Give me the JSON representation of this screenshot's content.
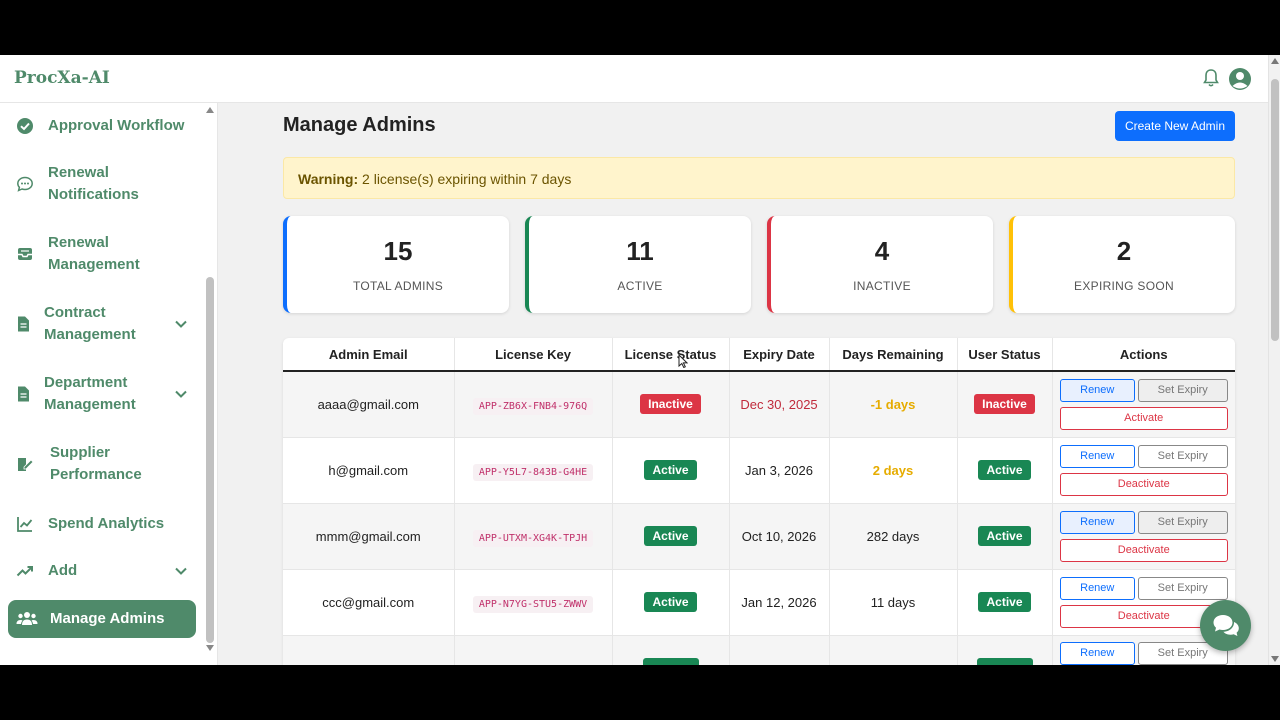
{
  "app": {
    "brand": "ProcXa-AI"
  },
  "sidebar": {
    "items": [
      {
        "line1": "Approval Workflow",
        "line2": "",
        "icon": "check-circle-icon",
        "chevron": false
      },
      {
        "line1": "Renewal",
        "line2": "Notifications",
        "icon": "chat-dots-icon",
        "chevron": false
      },
      {
        "line1": "Renewal",
        "line2": "Management",
        "icon": "inbox-icon",
        "chevron": false
      },
      {
        "line1": "Contract",
        "line2": "Management",
        "icon": "file-icon",
        "chevron": true
      },
      {
        "line1": "Department",
        "line2": "Management",
        "icon": "file-icon",
        "chevron": true
      },
      {
        "line1": "Supplier",
        "line2": "Performance",
        "icon": "edit-document-icon",
        "chevron": false
      },
      {
        "line1": "Spend Analytics",
        "line2": "",
        "icon": "line-chart-icon",
        "chevron": false
      },
      {
        "line1": "Add",
        "line2": "",
        "icon": "trend-up-icon",
        "chevron": true
      },
      {
        "line1": "Manage Admins",
        "line2": "",
        "icon": "users-icon",
        "chevron": false,
        "active": true
      }
    ]
  },
  "main": {
    "title": "Manage Admins",
    "create_button": "Create New Admin",
    "warning": {
      "label": "Warning:",
      "text": "2 license(s) expiring within 7 days"
    }
  },
  "stats": [
    {
      "value": "15",
      "label": "TOTAL ADMINS",
      "color": "#0d6efd"
    },
    {
      "value": "11",
      "label": "ACTIVE",
      "color": "#198754"
    },
    {
      "value": "4",
      "label": "INACTIVE",
      "color": "#dc3545"
    },
    {
      "value": "2",
      "label": "EXPIRING SOON",
      "color": "#ffc107"
    }
  ],
  "table": {
    "headers": [
      "Admin Email",
      "License Key",
      "License Status",
      "Expiry Date",
      "Days Remaining",
      "User Status",
      "Actions"
    ],
    "rows": [
      {
        "email": "aaaa@gmail.com",
        "key": "APP-ZB6X-FNB4-976Q",
        "license_status": "Inactive",
        "expiry": "Dec 30, 2025",
        "days": "-1 days",
        "user_status": "Inactive",
        "renew": "Renew",
        "set_expiry": "Set Expiry",
        "toggle": "Activate"
      },
      {
        "email": "h@gmail.com",
        "key": "APP-Y5L7-843B-G4HE",
        "license_status": "Active",
        "expiry": "Jan 3, 2026",
        "days": "2 days",
        "user_status": "Active",
        "renew": "Renew",
        "set_expiry": "Set Expiry",
        "toggle": "Deactivate"
      },
      {
        "email": "mmm@gmail.com",
        "key": "APP-UTXM-XG4K-TPJH",
        "license_status": "Active",
        "expiry": "Oct 10, 2026",
        "days": "282 days",
        "user_status": "Active",
        "renew": "Renew",
        "set_expiry": "Set Expiry",
        "toggle": "Deactivate"
      },
      {
        "email": "ccc@gmail.com",
        "key": "APP-N7YG-STU5-ZWWV",
        "license_status": "Active",
        "expiry": "Jan 12, 2026",
        "days": "11 days",
        "user_status": "Active",
        "renew": "Renew",
        "set_expiry": "Set Expiry",
        "toggle": "Deactivate"
      },
      {
        "email": "",
        "key": "",
        "license_status": "",
        "expiry": "",
        "days": "",
        "user_status": "",
        "renew": "Renew",
        "set_expiry": "Set Expiry",
        "toggle": ""
      }
    ]
  },
  "colors": {
    "brand": "#4f8a6a",
    "primary": "#0d6efd",
    "danger": "#dc3545",
    "success": "#198754",
    "warning": "#ffc107"
  }
}
